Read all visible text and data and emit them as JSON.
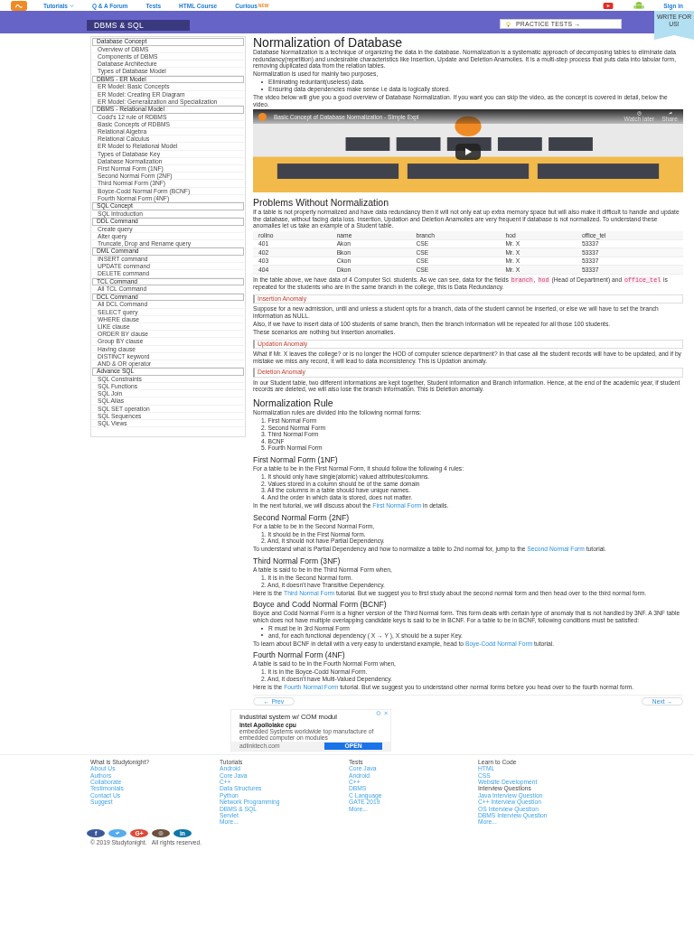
{
  "nav": {
    "items": [
      {
        "label": "Tutorials",
        "caret": true
      },
      {
        "label": "Q & A Forum"
      },
      {
        "label": "Tests"
      },
      {
        "label": "HTML Course"
      },
      {
        "label": "Curious",
        "badge": "NEW"
      }
    ],
    "sign_in": "Sign in"
  },
  "banner": {
    "title": "DBMS & SQL",
    "practice": "PRACTICE TESTS →",
    "ribbon": "WRITE FOR US!"
  },
  "sidebar": [
    {
      "kind": "header",
      "label": "Database Concept"
    },
    {
      "kind": "item",
      "label": "Overview of DBMS"
    },
    {
      "kind": "item",
      "label": "Components of DBMS"
    },
    {
      "kind": "item",
      "label": "Database Architecture"
    },
    {
      "kind": "item",
      "label": "Types of Database Model"
    },
    {
      "kind": "header",
      "label": "DBMS - ER Model"
    },
    {
      "kind": "item",
      "label": "ER Model: Basic Concepts"
    },
    {
      "kind": "item",
      "label": "ER Model: Creating ER Diagram"
    },
    {
      "kind": "item",
      "label": "ER Model: Generalization and Specialization"
    },
    {
      "kind": "header",
      "label": "DBMS - Relational Model"
    },
    {
      "kind": "item",
      "label": "Codd's 12 rule of RDBMS"
    },
    {
      "kind": "item",
      "label": "Basic Concepts of RDBMS"
    },
    {
      "kind": "item",
      "label": "Relational Algebra"
    },
    {
      "kind": "item",
      "label": "Relational Calculus"
    },
    {
      "kind": "item",
      "label": "ER Model to Relational Model"
    },
    {
      "kind": "item",
      "label": "Types of Database Key"
    },
    {
      "kind": "item",
      "label": "Database Normalization"
    },
    {
      "kind": "item",
      "label": "First Normal Form (1NF)"
    },
    {
      "kind": "item",
      "label": "Second Normal Form (2NF)"
    },
    {
      "kind": "item",
      "label": "Third Normal Form (3NF)"
    },
    {
      "kind": "item",
      "label": "Boyce-Codd Normal Form (BCNF)"
    },
    {
      "kind": "item",
      "label": "Fourth Normal Form (4NF)"
    },
    {
      "kind": "header",
      "label": "SQL Concept"
    },
    {
      "kind": "item",
      "label": "SQL Introduction"
    },
    {
      "kind": "header",
      "label": "DDL Command"
    },
    {
      "kind": "item",
      "label": "Create query"
    },
    {
      "kind": "item",
      "label": "Alter query"
    },
    {
      "kind": "item",
      "label": "Truncate, Drop and Rename query"
    },
    {
      "kind": "header",
      "label": "DML Command"
    },
    {
      "kind": "item",
      "label": "INSERT command"
    },
    {
      "kind": "item",
      "label": "UPDATE command"
    },
    {
      "kind": "item",
      "label": "DELETE command"
    },
    {
      "kind": "header",
      "label": "TCL Command"
    },
    {
      "kind": "item",
      "label": "All TCL Command"
    },
    {
      "kind": "header",
      "label": "DCL Command"
    },
    {
      "kind": "item",
      "label": "All DCL Command"
    },
    {
      "kind": "item",
      "label": "SELECT query"
    },
    {
      "kind": "item",
      "label": "WHERE clause"
    },
    {
      "kind": "item",
      "label": "LIKE clause"
    },
    {
      "kind": "item",
      "label": "ORDER BY clause"
    },
    {
      "kind": "item",
      "label": "Group BY clause"
    },
    {
      "kind": "item",
      "label": "Having clause"
    },
    {
      "kind": "item",
      "label": "DISTINCT keyword"
    },
    {
      "kind": "item",
      "label": "AND & OR operator"
    },
    {
      "kind": "header",
      "label": "Advance SQL"
    },
    {
      "kind": "item",
      "label": "SQL Constraints"
    },
    {
      "kind": "item",
      "label": "SQL Functions"
    },
    {
      "kind": "item",
      "label": "SQL Join"
    },
    {
      "kind": "item",
      "label": "SQL Alias"
    },
    {
      "kind": "item",
      "label": "SQL SET operation"
    },
    {
      "kind": "item",
      "label": "SQL Sequences"
    },
    {
      "kind": "item",
      "label": "SQL Views"
    }
  ],
  "content": [
    {
      "kind": "title",
      "text": "Normalization of Database"
    },
    {
      "kind": "para",
      "text": "Database Normalization is a technique of organizing the data in the database. Normalization is a systematic approach of decomposing tables to eliminate data redundancy(repetition) and undesirable characteristics like Insertion, Update and Deletion Anamolies. It is a multi-step process that puts data into tabular form, removing duplicated data from the relation tables."
    },
    {
      "kind": "para",
      "text": "Normalization is used for mainly two purposes,"
    },
    {
      "kind": "bullets",
      "items": [
        "Eliminating reduntant(useless) data.",
        "Ensuring data dependencies make sense i.e data is logically stored."
      ]
    },
    {
      "kind": "para",
      "text": "The video below will give you a good overview of Database Normalization. If you want you can skip the video, as the concept is covered in detail, below the video."
    },
    {
      "kind": "video",
      "title": "Basic Concept of Database Normalization - Simple Expl",
      "watch": "Watch later",
      "share": "Share"
    },
    {
      "kind": "heading",
      "text": "Problems Without Normalization"
    },
    {
      "kind": "para",
      "text": "If a table is not properly normalized and have data redundancy then it will not only eat up extra memory space but will also make it difficult to handle and update the database, without facing data loss. Insertion, Updation and Deletion Anamolies are very frequent if database is not normalized. To understand these anomalies let us take an example of a Student table."
    },
    {
      "kind": "table",
      "columns": [
        "rollno",
        "name",
        "branch",
        "hod",
        "office_tel"
      ],
      "rows": [
        [
          "401",
          "Akon",
          "CSE",
          "Mr. X",
          "53337"
        ],
        [
          "402",
          "Bkon",
          "CSE",
          "Mr. X",
          "53337"
        ],
        [
          "403",
          "Ckon",
          "CSE",
          "Mr. X",
          "53337"
        ],
        [
          "404",
          "Dkon",
          "CSE",
          "Mr. X",
          "53337"
        ]
      ]
    },
    {
      "kind": "para",
      "parts": [
        {
          "kind": "text",
          "text": "In the table above, we have data of 4 Computer Sci. students. As we can see, data for the fields "
        },
        {
          "kind": "code",
          "text": "branch"
        },
        {
          "kind": "text",
          "text": ", "
        },
        {
          "kind": "code",
          "text": "hod"
        },
        {
          "kind": "text",
          "text": " (Head of Department) and "
        },
        {
          "kind": "code",
          "text": "office_tel"
        },
        {
          "kind": "text",
          "text": " is repeated for the students who are in the same branch in the college, this is Data Redundancy."
        }
      ]
    },
    {
      "kind": "callout",
      "text": "Insertion Anomaly"
    },
    {
      "kind": "para",
      "text": "Suppose for a new admission, until and unless a student opts for a branch, data of the student cannot be inserted, or else we will have to set the branch information as NULL."
    },
    {
      "kind": "para",
      "text": "Also, if we have to insert data of 100 students of same branch, then the branch information will be repeated for all those 100 students."
    },
    {
      "kind": "para",
      "text": "These scenarios are nothing but Insertion anomalies."
    },
    {
      "kind": "callout",
      "text": "Updation Anomaly"
    },
    {
      "kind": "para",
      "text": "What if Mr. X leaves the college? or is no longer the HOD of computer science department? In that case all the student records will have to be updated, and if by mistake we miss any record, it will lead to data inconsistency. This is Updation anomaly."
    },
    {
      "kind": "callout",
      "text": "Deletion Anomaly"
    },
    {
      "kind": "para",
      "text": "In our Student table, two different informations are kept together, Student information and Branch information. Hence, at the end of the academic year, if student records are deleted, we will also lose the branch information. This is Deletion anomaly."
    },
    {
      "kind": "heading",
      "text": "Normalization Rule"
    },
    {
      "kind": "para",
      "text": "Normalization rules are divided into the following normal forms:"
    },
    {
      "kind": "numbers",
      "items": [
        {
          "num": "1.",
          "text": "First Normal Form"
        },
        {
          "num": "2.",
          "text": "Second Normal Form"
        },
        {
          "num": "3.",
          "text": "Third Normal Form"
        },
        {
          "num": "4.",
          "text": "BCNF"
        },
        {
          "num": "5.",
          "text": "Fourth Normal Form"
        }
      ]
    },
    {
      "kind": "subheading",
      "text": "First Normal Form (1NF)"
    },
    {
      "kind": "para",
      "text": "For a table to be in the First Normal Form, it should follow the following 4 rules:"
    },
    {
      "kind": "numbers",
      "items": [
        {
          "num": "1.",
          "text": "It should only have single(atomic) valued attributes/columns."
        },
        {
          "num": "2.",
          "text": "Values stored in a column should be of the same domain"
        },
        {
          "num": "3.",
          "text": "All the columns in a table should have unique names."
        },
        {
          "num": "4.",
          "text": "And the order in which data is stored, does not matter."
        }
      ]
    },
    {
      "kind": "para",
      "parts": [
        {
          "kind": "text",
          "text": "In the next tutorial, we will discuss about the "
        },
        {
          "kind": "link",
          "text": "First Normal Form"
        },
        {
          "kind": "text",
          "text": " in details."
        }
      ]
    },
    {
      "kind": "subheading",
      "text": "Second Normal Form (2NF)"
    },
    {
      "kind": "para",
      "text": "For a table to be in the Second Normal Form,"
    },
    {
      "kind": "numbers",
      "items": [
        {
          "num": "1.",
          "text": "It should be in the First Normal form."
        },
        {
          "num": "2.",
          "text": "And, it should not have Partial Dependency."
        }
      ]
    },
    {
      "kind": "para",
      "parts": [
        {
          "kind": "text",
          "text": "To understand what is Partial Dependency and how to normalize a table to 2nd normal for, jump to the "
        },
        {
          "kind": "link",
          "text": "Second Normal Form"
        },
        {
          "kind": "text",
          "text": " tutorial."
        }
      ]
    },
    {
      "kind": "subheading",
      "text": "Third Normal Form (3NF)"
    },
    {
      "kind": "para",
      "text": "A table is said to be in the Third Normal Form when,"
    },
    {
      "kind": "numbers",
      "items": [
        {
          "num": "1.",
          "text": "It is in the Second Normal form."
        },
        {
          "num": "2.",
          "text": "And, it doesn't have Transitive Dependency."
        }
      ]
    },
    {
      "kind": "para",
      "parts": [
        {
          "kind": "text",
          "text": "Here is the "
        },
        {
          "kind": "link",
          "text": "Third Normal Form"
        },
        {
          "kind": "text",
          "text": " tutorial. But we suggest you to first study about the second normal form and then head over to the third normal form."
        }
      ]
    },
    {
      "kind": "subheading",
      "text": "Boyce and Codd Normal Form (BCNF)"
    },
    {
      "kind": "para",
      "text": "Boyce and Codd Normal Form is a higher version of the Third Normal form. This form deals with certain type of anomaly that is not handled by 3NF. A 3NF table which does not have multiple overlapping candidate keys is said to be in BCNF. For a table to be in BCNF, following conditions must be satisfied:"
    },
    {
      "kind": "bullets",
      "items": [
        "R must be in 3rd Normal Form",
        "and, for each functional dependency ( X → Y ), X should be a super Key."
      ]
    },
    {
      "kind": "para",
      "parts": [
        {
          "kind": "text",
          "text": "To learn about BCNF in detail with a very easy to understand example, head to "
        },
        {
          "kind": "link",
          "text": "Boye-Codd Normal Form"
        },
        {
          "kind": "text",
          "text": " tutorial."
        }
      ]
    },
    {
      "kind": "subheading",
      "text": "Fourth Normal Form (4NF)"
    },
    {
      "kind": "para",
      "text": "A table is said to be in the Fourth Normal Form when,"
    },
    {
      "kind": "numbers",
      "items": [
        {
          "num": "1.",
          "text": "It is in the Boyce-Codd Normal Form."
        },
        {
          "num": "2.",
          "text": "And, it doesn't have Multi-Valued Dependency."
        }
      ]
    },
    {
      "kind": "para",
      "parts": [
        {
          "kind": "text",
          "text": "Here is the "
        },
        {
          "kind": "link",
          "text": "Fourth Normal Form"
        },
        {
          "kind": "text",
          "text": " tutorial. But we suggest you to understand other normal forms before you head over to the fourth normal form."
        }
      ]
    },
    {
      "kind": "pager",
      "prev": "← Prev",
      "next": "Next →"
    }
  ],
  "ad": {
    "title": "Industrial system w/ COM modul",
    "subtitle": "Intel Apollolake cpu",
    "body": "embedded Systems worldwide top manufacture of embedded computer on modules",
    "domain": "adlinktech.com",
    "button": "OPEN"
  },
  "footer": {
    "columns": [
      {
        "groups": [
          {
            "heading": "What is Studytonight?",
            "links": [
              "About Us",
              "Authors",
              "Collaborate",
              "Testimonials",
              "Contact Us",
              "Suggest"
            ]
          }
        ]
      },
      {
        "groups": [
          {
            "heading": "Tutorials",
            "links": [
              "Android",
              "Core Java",
              "C++",
              "Data Structures",
              "Python",
              "Network Programming",
              "DBMS & SQL",
              "Servlet",
              "More..."
            ]
          }
        ]
      },
      {
        "groups": [
          {
            "heading": "Tests",
            "links": [
              "Core Java",
              "Android",
              "C++",
              "DBMS",
              "C Language",
              "GATE 2019",
              "More..."
            ]
          }
        ]
      },
      {
        "groups": [
          {
            "heading": "Learn to Code",
            "links": [
              "HTML",
              "CSS",
              "Website Development"
            ]
          },
          {
            "heading": "Interview Questions",
            "links": [
              "Java Interview Question",
              "C++ Interview Question",
              "OS Interview Question",
              "DBMS Interview Question",
              "More..."
            ]
          }
        ]
      }
    ],
    "social": [
      {
        "kind": "letter",
        "glyph": "f",
        "color": "#3b5998"
      },
      {
        "kind": "bird",
        "color": "#55acee"
      },
      {
        "kind": "letter",
        "glyph": "G+",
        "color": "#dd4b39"
      },
      {
        "kind": "camera",
        "color": "#6b4f3f"
      },
      {
        "kind": "letter",
        "glyph": "in",
        "color": "#0e76a8"
      }
    ],
    "copyright": "© 2019 Studytonight.   All rights reserved."
  }
}
